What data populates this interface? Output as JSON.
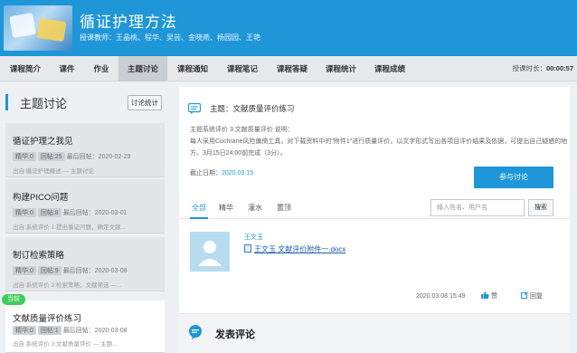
{
  "header": {
    "course_title": "循证护理方法",
    "teachers": "授课教师：王晶桃、程华、吴芸、金晓燕、杨园园、王艳"
  },
  "nav": {
    "items": [
      "课程简介",
      "课件",
      "作业",
      "主题讨论",
      "课程通知",
      "课程笔记",
      "课程答疑",
      "课程统计",
      "课程成绩"
    ],
    "active": "主题讨论",
    "timer_label": "授课时长：",
    "timer_value": "00:00:57"
  },
  "sidebar": {
    "title": "主题讨论",
    "stat_button": "讨论统计",
    "topics": [
      {
        "title": "循证护理之我见",
        "tag1": "精华:0",
        "tag2": "回帖:25",
        "last": "最后回帖：2020-02-29",
        "desc": "出自:循证护理概述 — 主题讨论"
      },
      {
        "title": "构建PICO问题",
        "tag1": "精华:0",
        "tag2": "回帖:8",
        "last": "最后回帖：2020-03-01",
        "desc": "出自:系统评价 1:提出循证问题，确定文献..."
      },
      {
        "title": "制订检索策略",
        "tag1": "精华:0",
        "tag2": "回帖:9",
        "last": "最后回帖：2020-03-08",
        "desc": "出自:系统评价 2:检索策略，文献筛选 —..."
      },
      {
        "title": "文献质量评价练习",
        "tag1": "精华:0",
        "tag2": "回帖:1",
        "last": "最后回帖：2020-03-08",
        "desc": "出自:系统评价 3:文献质量评价 — 主题..."
      }
    ],
    "current_badge": "当前"
  },
  "main": {
    "topic_title": "主题：文献质量评价练习",
    "req_title": "主题系统评价 3:文献质量评价 说明：",
    "req_body": "每人采用Cochrane风险偏倚工具，对下载资料中的\"附件1\"进行质量评价，以文字形式写出各项目评价结果及依据，可提出自己疑惑的地方。3月15日24:00前完成（3分）。",
    "deadline_label": "截止日期：",
    "deadline_value": "2020.03.15",
    "join_button": "参与讨论",
    "tabs": [
      "全部",
      "精华",
      "灌水",
      "置顶"
    ],
    "active_tab": "全部",
    "search_placeholder": "输入姓名、用户名",
    "search_button": "搜索",
    "post": {
      "author": "王文玉",
      "attachment": "王文玉 文献评价附件一.docx",
      "time": "2020.03.08 15:49",
      "like": "赞",
      "reply": "回复"
    },
    "reply_title": "发表评论"
  },
  "colors": {
    "accent": "#1e96d8",
    "badge": "#3ccf5a"
  }
}
